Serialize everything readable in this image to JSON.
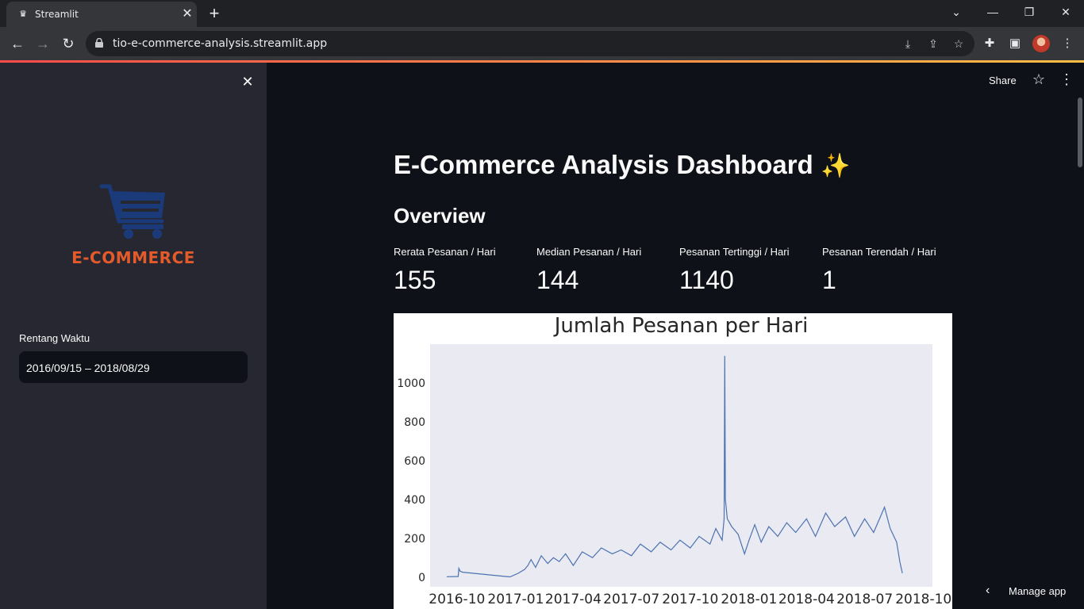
{
  "browser": {
    "tab_title": "Streamlit",
    "url": "tio-e-commerce-analysis.streamlit.app"
  },
  "sidebar": {
    "logo_text": "E-COMMERCE",
    "date_label": "Rentang Waktu",
    "date_value": "2016/09/15 – 2018/08/29"
  },
  "header": {
    "share_label": "Share"
  },
  "main": {
    "title": "E-Commerce Analysis Dashboard",
    "title_emoji": "✨",
    "subheader": "Overview",
    "metrics": [
      {
        "label": "Rerata Pesanan / Hari",
        "value": "155"
      },
      {
        "label": "Median Pesanan / Hari",
        "value": "144"
      },
      {
        "label": "Pesanan Tertinggi / Hari",
        "value": "1140"
      },
      {
        "label": "Pesanan Terendah / Hari",
        "value": "1"
      }
    ]
  },
  "footer": {
    "manage_label": "Manage app"
  },
  "chart_data": {
    "type": "line",
    "title": "Jumlah Pesanan per Hari",
    "xlabel": "",
    "ylabel": "",
    "x_ticks": [
      "2016-10",
      "2017-01",
      "2017-04",
      "2017-07",
      "2017-10",
      "2018-01",
      "2018-04",
      "2018-07",
      "2018-10"
    ],
    "y_ticks": [
      "0",
      "200",
      "400",
      "600",
      "800",
      "1000"
    ],
    "ylim": [
      -50,
      1200
    ],
    "grid": false,
    "color": "#4c72b0",
    "background": "#eaeaf2",
    "series": [
      {
        "x": [
          "2016-09-15",
          "2016-10-03",
          "2016-10-04",
          "2016-10-06",
          "2016-10-10",
          "2016-12-23",
          "2017-01-05",
          "2017-01-15",
          "2017-01-20",
          "2017-01-25",
          "2017-02-01",
          "2017-02-10",
          "2017-02-20",
          "2017-03-01",
          "2017-03-10",
          "2017-03-20",
          "2017-04-01",
          "2017-04-15",
          "2017-05-01",
          "2017-05-15",
          "2017-06-01",
          "2017-06-15",
          "2017-07-01",
          "2017-07-15",
          "2017-08-01",
          "2017-08-15",
          "2017-09-01",
          "2017-09-15",
          "2017-10-01",
          "2017-10-15",
          "2017-11-01",
          "2017-11-10",
          "2017-11-20",
          "2017-11-23",
          "2017-11-24",
          "2017-11-25",
          "2017-11-28",
          "2017-12-05",
          "2017-12-15",
          "2017-12-25",
          "2018-01-01",
          "2018-01-10",
          "2018-01-20",
          "2018-02-01",
          "2018-02-15",
          "2018-03-01",
          "2018-03-15",
          "2018-04-01",
          "2018-04-15",
          "2018-05-01",
          "2018-05-15",
          "2018-06-01",
          "2018-06-15",
          "2018-07-01",
          "2018-07-15",
          "2018-08-01",
          "2018-08-10",
          "2018-08-20",
          "2018-08-25",
          "2018-08-29"
        ],
        "y": [
          2,
          3,
          45,
          30,
          25,
          1,
          20,
          40,
          60,
          90,
          50,
          110,
          70,
          100,
          80,
          120,
          60,
          130,
          100,
          150,
          120,
          140,
          110,
          170,
          130,
          180,
          140,
          190,
          150,
          210,
          170,
          250,
          190,
          300,
          1140,
          400,
          300,
          260,
          220,
          120,
          190,
          270,
          180,
          260,
          210,
          280,
          230,
          300,
          210,
          330,
          260,
          310,
          210,
          300,
          230,
          360,
          250,
          180,
          80,
          20
        ]
      }
    ]
  }
}
